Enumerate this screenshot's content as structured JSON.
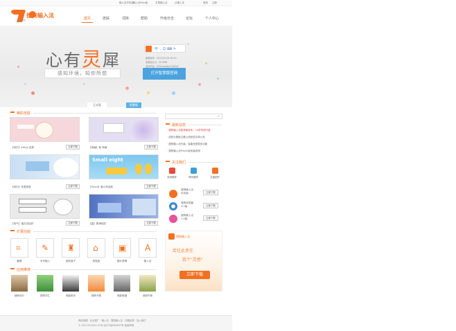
{
  "topbar": {
    "links": [
      "输入法手机版",
      "输入法Mac版",
      "五笔输入法",
      "云输入法"
    ],
    "right_links": [
      "登录",
      "注册"
    ]
  },
  "logo": {
    "text": "搜狗输入法",
    "sub": "一直在进步"
  },
  "nav": {
    "items": [
      "首页",
      "皮肤",
      "词库",
      "帮助",
      "升级日志",
      "论坛",
      "个人中心"
    ],
    "active_index": 0
  },
  "hero": {
    "title_pre": "心有",
    "title_accent": "灵",
    "title_post": "犀",
    "tagline": "感知环境，知你所想",
    "info_lines": [
      "最新版本：2013.09.26  V6.9d",
      "安装包大小：25.5MB",
      "支持平台：XP/Vista/Win7/Win8"
    ],
    "cta_label": "打开智慧版官网",
    "switch": {
      "normal": "正式版",
      "smart": "智慧版",
      "active": "smart"
    }
  },
  "skins": {
    "title": "精彩皮肤",
    "items": [
      {
        "label": "【柯尔】KiDyp 皮肤",
        "download": "立即下载",
        "color": "#f6d7dc"
      },
      {
        "label": "【荷塘】紫 荷塘",
        "download": "立即下载",
        "color": "#d9d1ec"
      },
      {
        "label": "【柯尔】布蕾皮肤",
        "download": "立即下载",
        "color": "#cfe2f2"
      },
      {
        "label": "【Small】最小的皮肤",
        "download": "立即下载",
        "color": "#9fd4f0"
      },
      {
        "label": "【帝气】谁在说话好",
        "download": "立即下载",
        "color": "#e8e8e8"
      },
      {
        "label": "【蓝】雾海相恋",
        "download": "立即下载",
        "color": "#6f8fcc"
      }
    ]
  },
  "tools": {
    "title": "扩展功能",
    "items": [
      "截屏",
      "手写输入",
      "皮肤盒子",
      "剪贴板",
      "图片表情",
      "输入法"
    ]
  },
  "apps": {
    "title": "应用推荐",
    "items": [
      "细雨流行",
      "搜狗词汇",
      "电脑助手",
      "搜狗书签",
      "电影频道",
      "卓越书库"
    ]
  },
  "sidebar": {
    "search_placeholder": "",
    "news_title": "最新动态",
    "news": [
      {
        "text": "搜狗输入法智慧版发布，10秒完成升级",
        "hot": true
      },
      {
        "text": "皮肤大赛新主题上线获奖名单公布",
        "hot": false
      },
      {
        "text": "搜狗输入法升级，智能改进很多功能",
        "hot": false
      },
      {
        "text": "搜狗输入法Pinyin版安装说明",
        "hot": false
      }
    ],
    "follow_title": "关注我们",
    "follow": [
      "新浪微博",
      "腾讯微博",
      "百度贴吧"
    ],
    "products": [
      {
        "name": "搜狗输入法",
        "sub": "手机版",
        "download": "立即下载"
      },
      {
        "name": "搜狗浏览器",
        "sub": "4.2版",
        "download": "立即下载"
      },
      {
        "name": "搜狗输入法",
        "sub": "1.4版",
        "download": "立即下载"
      }
    ],
    "ad": {
      "brand": "搜狗输入法",
      "line1": "若往此意在",
      "line2": "我个\"灵感\"",
      "cta": "立即下载"
    }
  },
  "footer": {
    "links": "网站地图 · 企业推广 · 输入法 · 搜狗输入法 · 问题反馈 · 加入我们",
    "copyright": "© 2013 SOGOU.COM  京ICP证050897号  免费声明"
  },
  "colors": {
    "accent": "#f37021",
    "blue": "#4aa3df"
  }
}
